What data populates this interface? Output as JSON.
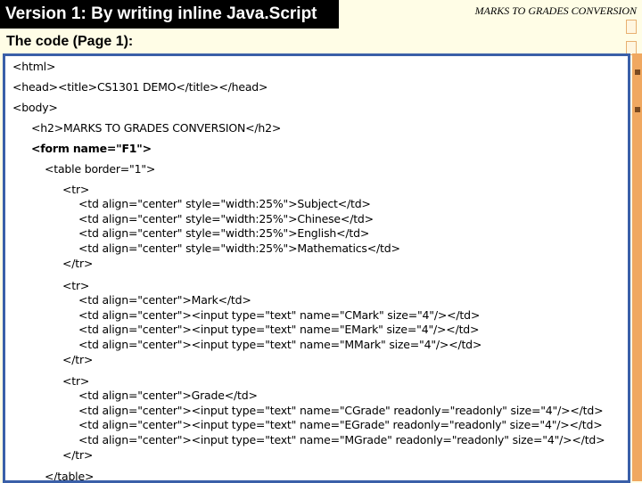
{
  "slide": {
    "title": "Version 1: By writing inline Java.Script",
    "header_caption": "MARKS TO GRADES CONVERSION",
    "subtitle": "The code (Page 1):"
  },
  "code_lines": [
    {
      "text": "<html>",
      "bold": false
    },
    {
      "text": "<head><title>CS1301 DEMO</title></head>",
      "bold": false
    },
    {
      "text": "<body>",
      "bold": false
    },
    {
      "text": "<h2>MARKS TO GRADES CONVERSION</h2>",
      "bold": false
    },
    {
      "text": "<form name=\"F1\">",
      "bold": true
    },
    {
      "text": "<table border=\"1\">",
      "bold": false
    },
    {
      "text": "<tr>",
      "bold": false
    },
    {
      "text": "<td align=\"center\" style=\"width:25%\">Subject</td>",
      "bold": false
    },
    {
      "text": "<td align=\"center\" style=\"width:25%\">Chinese</td>",
      "bold": false
    },
    {
      "text": "<td align=\"center\" style=\"width:25%\">English</td>",
      "bold": false
    },
    {
      "text": "<td align=\"center\" style=\"width:25%\">Mathematics</td>",
      "bold": false
    },
    {
      "text": "</tr>",
      "bold": false
    },
    {
      "text": "<tr>",
      "bold": false
    },
    {
      "text": "<td align=\"center\">Mark</td>",
      "bold": false
    },
    {
      "text": "<td align=\"center\"><input type=\"text\" name=\"CMark\" size=\"4\"/></td>",
      "bold": false
    },
    {
      "text": "<td align=\"center\"><input type=\"text\" name=\"EMark\" size=\"4\"/></td>",
      "bold": false
    },
    {
      "text": "<td align=\"center\"><input type=\"text\" name=\"MMark\" size=\"4\"/></td>",
      "bold": false
    },
    {
      "text": "</tr>",
      "bold": false
    },
    {
      "text": "<tr>",
      "bold": false
    },
    {
      "text": "<td align=\"center\">Grade</td>",
      "bold": false
    },
    {
      "text": "<td align=\"center\"><input type=\"text\" name=\"CGrade\" readonly=\"readonly\" size=\"4\"/></td>",
      "bold": false
    },
    {
      "text": "<td align=\"center\"><input type=\"text\" name=\"EGrade\" readonly=\"readonly\" size=\"4\"/></td>",
      "bold": false
    },
    {
      "text": "<td align=\"center\"><input type=\"text\" name=\"MGrade\" readonly=\"readonly\" size=\"4\"/></td>",
      "bold": false
    },
    {
      "text": "</tr>",
      "bold": false
    },
    {
      "text": "</table>",
      "bold": false
    }
  ]
}
